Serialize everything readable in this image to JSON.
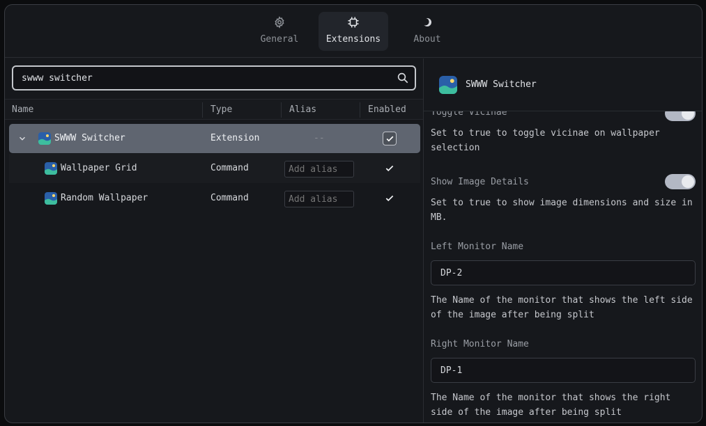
{
  "tabs": [
    {
      "label": "General",
      "icon": "gear-icon",
      "active": false
    },
    {
      "label": "Extensions",
      "icon": "cpu-icon",
      "active": true
    },
    {
      "label": "About",
      "icon": "moon-icon",
      "active": false
    }
  ],
  "search": {
    "value": "swww switcher",
    "icon": "search-icon"
  },
  "table": {
    "columns": [
      "Name",
      "Type",
      "Alias",
      "Enabled"
    ],
    "rows": [
      {
        "name": "SWWW Switcher",
        "type": "Extension",
        "alias": "--",
        "enabled": true,
        "expanded": true,
        "selected": true
      },
      {
        "name": "Wallpaper Grid",
        "type": "Command",
        "alias_placeholder": "Add alias",
        "enabled": true
      },
      {
        "name": "Random Wallpaper",
        "type": "Command",
        "alias_placeholder": "Add alias",
        "enabled": true
      }
    ]
  },
  "detail": {
    "title": "SWWW Switcher",
    "partial_label": "Toggle Vicinae",
    "toggle_vicinae_desc": "Set to true to toggle vicinae on wallpaper selection",
    "show_image_details": {
      "label": "Show Image Details",
      "desc": "Set to true to show image dimensions and size in MB.",
      "value": true
    },
    "left_monitor": {
      "label": "Left Monitor Name",
      "value": "DP-2",
      "desc": "The Name of the monitor that shows the left side of the image after being split"
    },
    "right_monitor": {
      "label": "Right Monitor Name",
      "value": "DP-1",
      "desc": "The Name of the monitor that shows the right side of the image after being split"
    }
  },
  "colors": {
    "accent": "#b3b8c4",
    "selected_row": "#5f6570",
    "background": "#16181c"
  }
}
